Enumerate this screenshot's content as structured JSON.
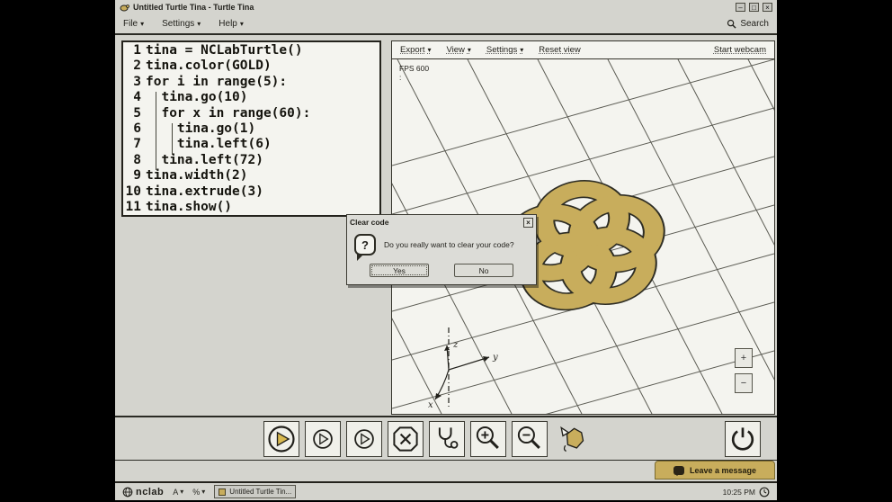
{
  "colors": {
    "gold": "#c8ad5c",
    "gold2": "#d9b94f",
    "ink": "#201f1a",
    "chrome": "#d4d4ce",
    "panel": "#f4f4ef",
    "grid": "#5c5c54",
    "dlg": "#dcdcd7"
  },
  "window": {
    "title": "Untitled Turtle Tina - Turtle Tina",
    "minimize": "–",
    "maximize": "□",
    "close": "×"
  },
  "menubar": {
    "items": [
      "File",
      "Settings",
      "Help"
    ],
    "dropdown_glyph": "▾",
    "search_label": "Search"
  },
  "editor": {
    "lines": [
      {
        "n": "1",
        "t": "tina = NCLabTurtle()"
      },
      {
        "n": "2",
        "t": "tina.color(GOLD)"
      },
      {
        "n": "3",
        "t": "for i in range(5):"
      },
      {
        "n": "4",
        "t": "  tina.go(10)"
      },
      {
        "n": "5",
        "t": "  for x in range(60):"
      },
      {
        "n": "6",
        "t": "    tina.go(1)"
      },
      {
        "n": "7",
        "t": "    tina.left(6)"
      },
      {
        "n": "8",
        "t": "  tina.left(72)"
      },
      {
        "n": "9",
        "t": "tina.width(2)"
      },
      {
        "n": "10",
        "t": "tina.extrude(3)"
      },
      {
        "n": "11",
        "t": "tina.show()"
      }
    ]
  },
  "viewport": {
    "menu": [
      "Export",
      "View",
      "Settings",
      "Reset view"
    ],
    "webcam_label": "Start webcam",
    "fps": "FPS 600",
    "stats2": ":",
    "axes": {
      "x": "x",
      "y": "y",
      "z": "z"
    },
    "zoom_in": "+",
    "zoom_out": "−"
  },
  "dialog": {
    "title": "Clear code",
    "close": "×",
    "icon_glyph": "?",
    "message": "Do you really want to clear your code?",
    "yes": "Yes",
    "no": "No"
  },
  "toolbar": {
    "buttons": [
      "run",
      "play-medium",
      "play-slow",
      "stop",
      "debug",
      "zoom-in",
      "zoom-out",
      "clear-drawing",
      "power"
    ]
  },
  "footer": {
    "leave_message": "Leave a message"
  },
  "taskbar": {
    "brand": "nclab",
    "ctrl1": "A",
    "ctrl2": "%",
    "window_button": "Untitled Turtle Tin...",
    "time": "10:25 PM"
  }
}
